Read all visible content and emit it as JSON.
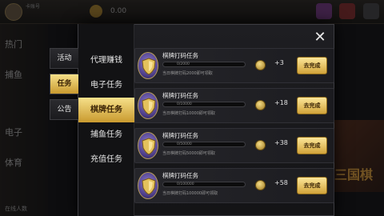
{
  "background": {
    "user": "卡账号",
    "coins": "0.00",
    "side_items": [
      "热门",
      "捕鱼",
      "电子",
      "体育"
    ],
    "bottom_text": "在线人数",
    "banner_text": "三国棋"
  },
  "modal": {
    "close_icon": "close-icon",
    "tabs": [
      {
        "label": "活动",
        "active": false
      },
      {
        "label": "任务",
        "active": true
      },
      {
        "label": "公告",
        "active": false
      }
    ],
    "submenu": [
      {
        "label": "代理赚钱",
        "active": false
      },
      {
        "label": "电子任务",
        "active": false
      },
      {
        "label": "棋牌任务",
        "active": true
      },
      {
        "label": "捕鱼任务",
        "active": false
      },
      {
        "label": "充值任务",
        "active": false
      }
    ],
    "tasks": [
      {
        "title": "棋牌打码任务",
        "progress": "0/2000",
        "progress_fraction": 0,
        "desc": "当日棋牌打码2000即可领取",
        "reward": "+3",
        "button": "去完成"
      },
      {
        "title": "棋牌打码任务",
        "progress": "0/10000",
        "progress_fraction": 0,
        "desc": "当日棋牌打码10000即可领取",
        "reward": "+18",
        "button": "去完成"
      },
      {
        "title": "棋牌打码任务",
        "progress": "0/50000",
        "progress_fraction": 0,
        "desc": "当日棋牌打码50000即可领取",
        "reward": "+38",
        "button": "去完成"
      },
      {
        "title": "棋牌打码任务",
        "progress": "0/100000",
        "progress_fraction": 0,
        "desc": "当日棋牌打码100000即可领取",
        "reward": "+58",
        "button": "去完成"
      }
    ]
  },
  "colors": {
    "accent_gold": "#d2a43a",
    "panel": "#1e1e22"
  }
}
